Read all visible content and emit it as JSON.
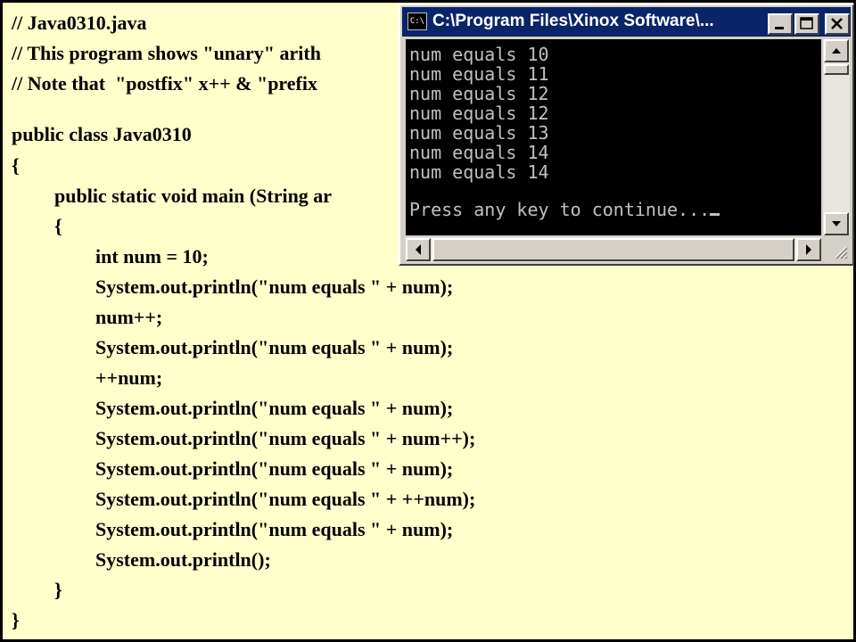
{
  "code": {
    "lines": [
      "// Java0310.java",
      "// This program shows \"unary\" arith",
      "// Note that  \"postfix\" x++ & \"prefix",
      "public class Java0310",
      "{",
      "public static void main (String ar",
      "{",
      "int num = 10;",
      "System.out.println(\"num equals \" + num);",
      "num++;",
      "System.out.println(\"num equals \" + num);",
      "++num;",
      "System.out.println(\"num equals \" + num);",
      "System.out.println(\"num equals \" + num++);",
      "System.out.println(\"num equals \" + num);",
      "System.out.println(\"num equals \" + ++num);",
      "System.out.println(\"num equals \" + num);",
      "System.out.println();",
      "}",
      "}"
    ]
  },
  "console": {
    "title": "C:\\Program Files\\Xinox Software\\...",
    "icon_label": "C:\\",
    "output": [
      "num equals 10",
      "num equals 11",
      "num equals 12",
      "num equals 12",
      "num equals 13",
      "num equals 14",
      "num equals 14"
    ],
    "prompt": "Press any key to continue..."
  },
  "colors": {
    "slide_background": "#ffffcc",
    "titlebar": "#0a246a",
    "console_text": "#c0c0c0"
  }
}
